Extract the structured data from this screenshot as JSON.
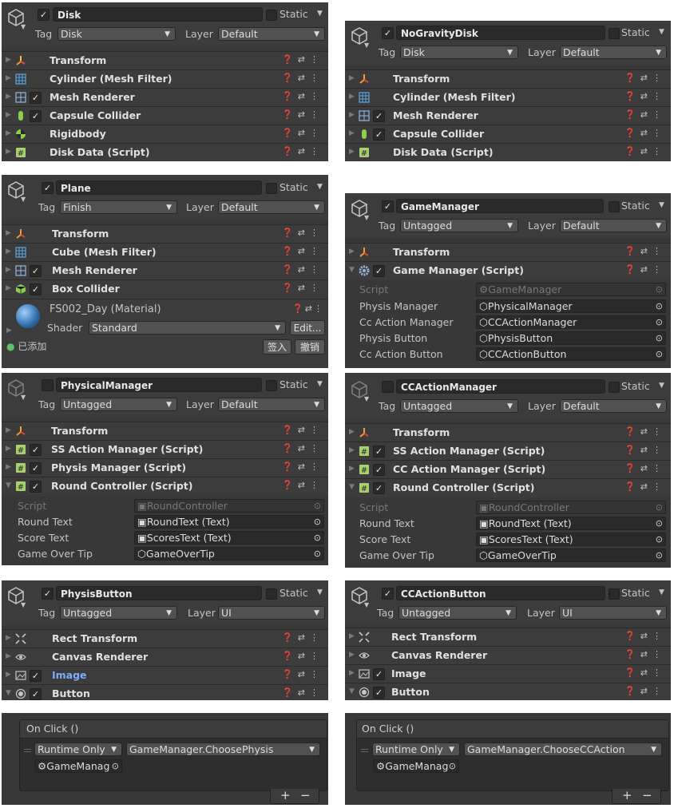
{
  "static_label": "Static",
  "tag_label": "Tag",
  "layer_label": "Layer",
  "disk": {
    "name": "Disk",
    "tag": "Disk",
    "layer": "Default",
    "components": [
      "Transform",
      "Cylinder (Mesh Filter)",
      "Mesh Renderer",
      "Capsule Collider",
      "Rigidbody",
      "Disk Data (Script)"
    ]
  },
  "nogravity": {
    "name": "NoGravityDisk",
    "tag": "Disk",
    "layer": "Default",
    "components": [
      "Transform",
      "Cylinder (Mesh Filter)",
      "Mesh Renderer",
      "Capsule Collider",
      "Disk Data (Script)"
    ]
  },
  "plane": {
    "name": "Plane",
    "tag": "Finish",
    "layer": "Default",
    "components": [
      "Transform",
      "Cube (Mesh Filter)",
      "Mesh Renderer",
      "Box Collider"
    ],
    "material": "FS002_Day (Material)",
    "shader_label": "Shader",
    "shader": "Standard",
    "edit": "Edit...",
    "added": "已添加",
    "checkin": "签入",
    "revert": "撤销"
  },
  "gamemanager": {
    "name": "GameManager",
    "tag": "Untagged",
    "layer": "Default",
    "components": [
      "Transform",
      "Game Manager (Script)"
    ],
    "fields": [
      {
        "label": "Script",
        "value": "GameManager"
      },
      {
        "label": "Physis Manager",
        "value": "PhysicalManager"
      },
      {
        "label": "Cc Action Manager",
        "value": "CCActionManager"
      },
      {
        "label": "Physis Button",
        "value": "PhysisButton"
      },
      {
        "label": "Cc Action Button",
        "value": "CCActionButton"
      }
    ]
  },
  "physical": {
    "name": "PhysicalManager",
    "tag": "Untagged",
    "layer": "Default",
    "components": [
      "Transform",
      "SS Action Manager (Script)",
      "Physis Manager (Script)",
      "Round Controller (Script)"
    ],
    "fields": [
      {
        "label": "Script",
        "value": "RoundController"
      },
      {
        "label": "Round Text",
        "value": "RoundText (Text)"
      },
      {
        "label": "Score Text",
        "value": "ScoresText (Text)"
      },
      {
        "label": "Game Over Tip",
        "value": "GameOverTip"
      }
    ]
  },
  "ccaction": {
    "name": "CCActionManager",
    "tag": "Untagged",
    "layer": "Default",
    "components": [
      "Transform",
      "SS Action Manager (Script)",
      "CC Action Manager (Script)",
      "Round Controller (Script)"
    ],
    "fields": [
      {
        "label": "Script",
        "value": "RoundController"
      },
      {
        "label": "Round Text",
        "value": "RoundText (Text)"
      },
      {
        "label": "Score Text",
        "value": "ScoresText (Text)"
      },
      {
        "label": "Game Over Tip",
        "value": "GameOverTip"
      }
    ]
  },
  "physisbtn": {
    "name": "PhysisButton",
    "tag": "Untagged",
    "layer": "UI",
    "components": [
      "Rect Transform",
      "Canvas Renderer",
      "Image",
      "Button"
    ]
  },
  "ccbtn": {
    "name": "CCActionButton",
    "tag": "Untagged",
    "layer": "UI",
    "components": [
      "Rect Transform",
      "Canvas Renderer",
      "Image",
      "Button"
    ]
  },
  "onclick1": {
    "title": "On Click ()",
    "mode": "Runtime Only",
    "func": "GameManager.ChoosePhysis",
    "obj": "GameManag"
  },
  "onclick2": {
    "title": "On Click ()",
    "mode": "Runtime Only",
    "func": "GameManager.ChooseCCAction",
    "obj": "GameManag"
  },
  "colors": {
    "panel": "#383838",
    "header": "#3c3c3c",
    "accent_blue": "#7aaefc"
  }
}
